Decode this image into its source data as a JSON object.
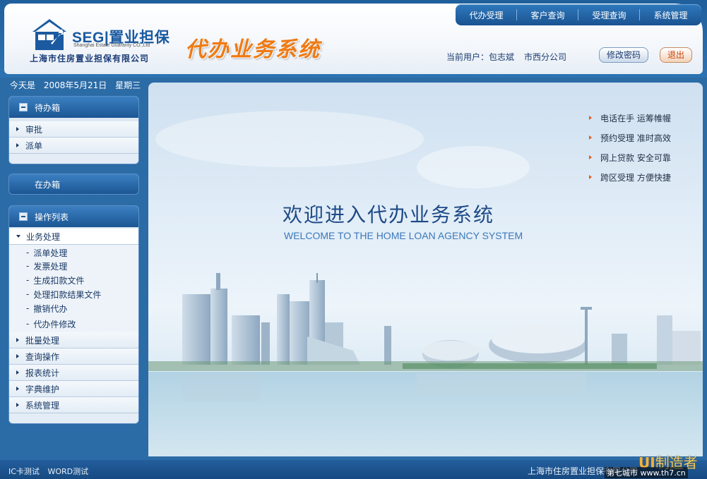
{
  "header": {
    "brand_code": "SEG",
    "brand_cn": "置业担保",
    "brand_en": "Shanghai Estate Guaranty CO.,Ltd",
    "company_name": "上海市住房置业担保有限公司",
    "system_title": "代办业务系统",
    "nav": [
      "代办受理",
      "客户查询",
      "受理查询",
      "系统管理"
    ],
    "user_label": "当前用户：包志斌",
    "branch": "市西分公司",
    "change_password": "修改密码",
    "logout": "退出"
  },
  "date_strip": {
    "label": "今天是",
    "date": "2008年5月21日",
    "weekday": "星期三"
  },
  "sidebar": {
    "inbox": {
      "title": "待办箱",
      "items": [
        "审批",
        "派单"
      ]
    },
    "in_progress": "在办箱",
    "operations": {
      "title": "操作列表",
      "expanded_item": "业务处理",
      "sub_items": [
        "派单处理",
        "发票处理",
        "生成扣款文件",
        "处理扣款结果文件",
        "撤销代办",
        "代办件修改"
      ],
      "items": [
        "批量处理",
        "查询操作",
        "报表统计",
        "字典维护",
        "系统管理"
      ]
    }
  },
  "main": {
    "features": [
      "电话在手 运筹帷幄",
      "预约受理 准时高效",
      "网上贷款 安全可靠",
      "跨区受理 方便快捷"
    ],
    "welcome_cn": "欢迎进入代办业务系统",
    "welcome_en": "WELCOME TO THE HOME LOAN AGENCY SYSTEM"
  },
  "footer": {
    "links": [
      "IC卡测试",
      "WORD测试"
    ],
    "company": "上海市住房置业担保有限公司"
  },
  "watermark": {
    "ui_mark": "UI",
    "ui_text": "制造者",
    "site": "第七城市 www.th7.cn"
  },
  "colors": {
    "brand_blue": "#1b5aa0",
    "title_orange": "#f07a12",
    "nav_blue": "#1a5391",
    "accent_arrow": "#e55c12"
  }
}
